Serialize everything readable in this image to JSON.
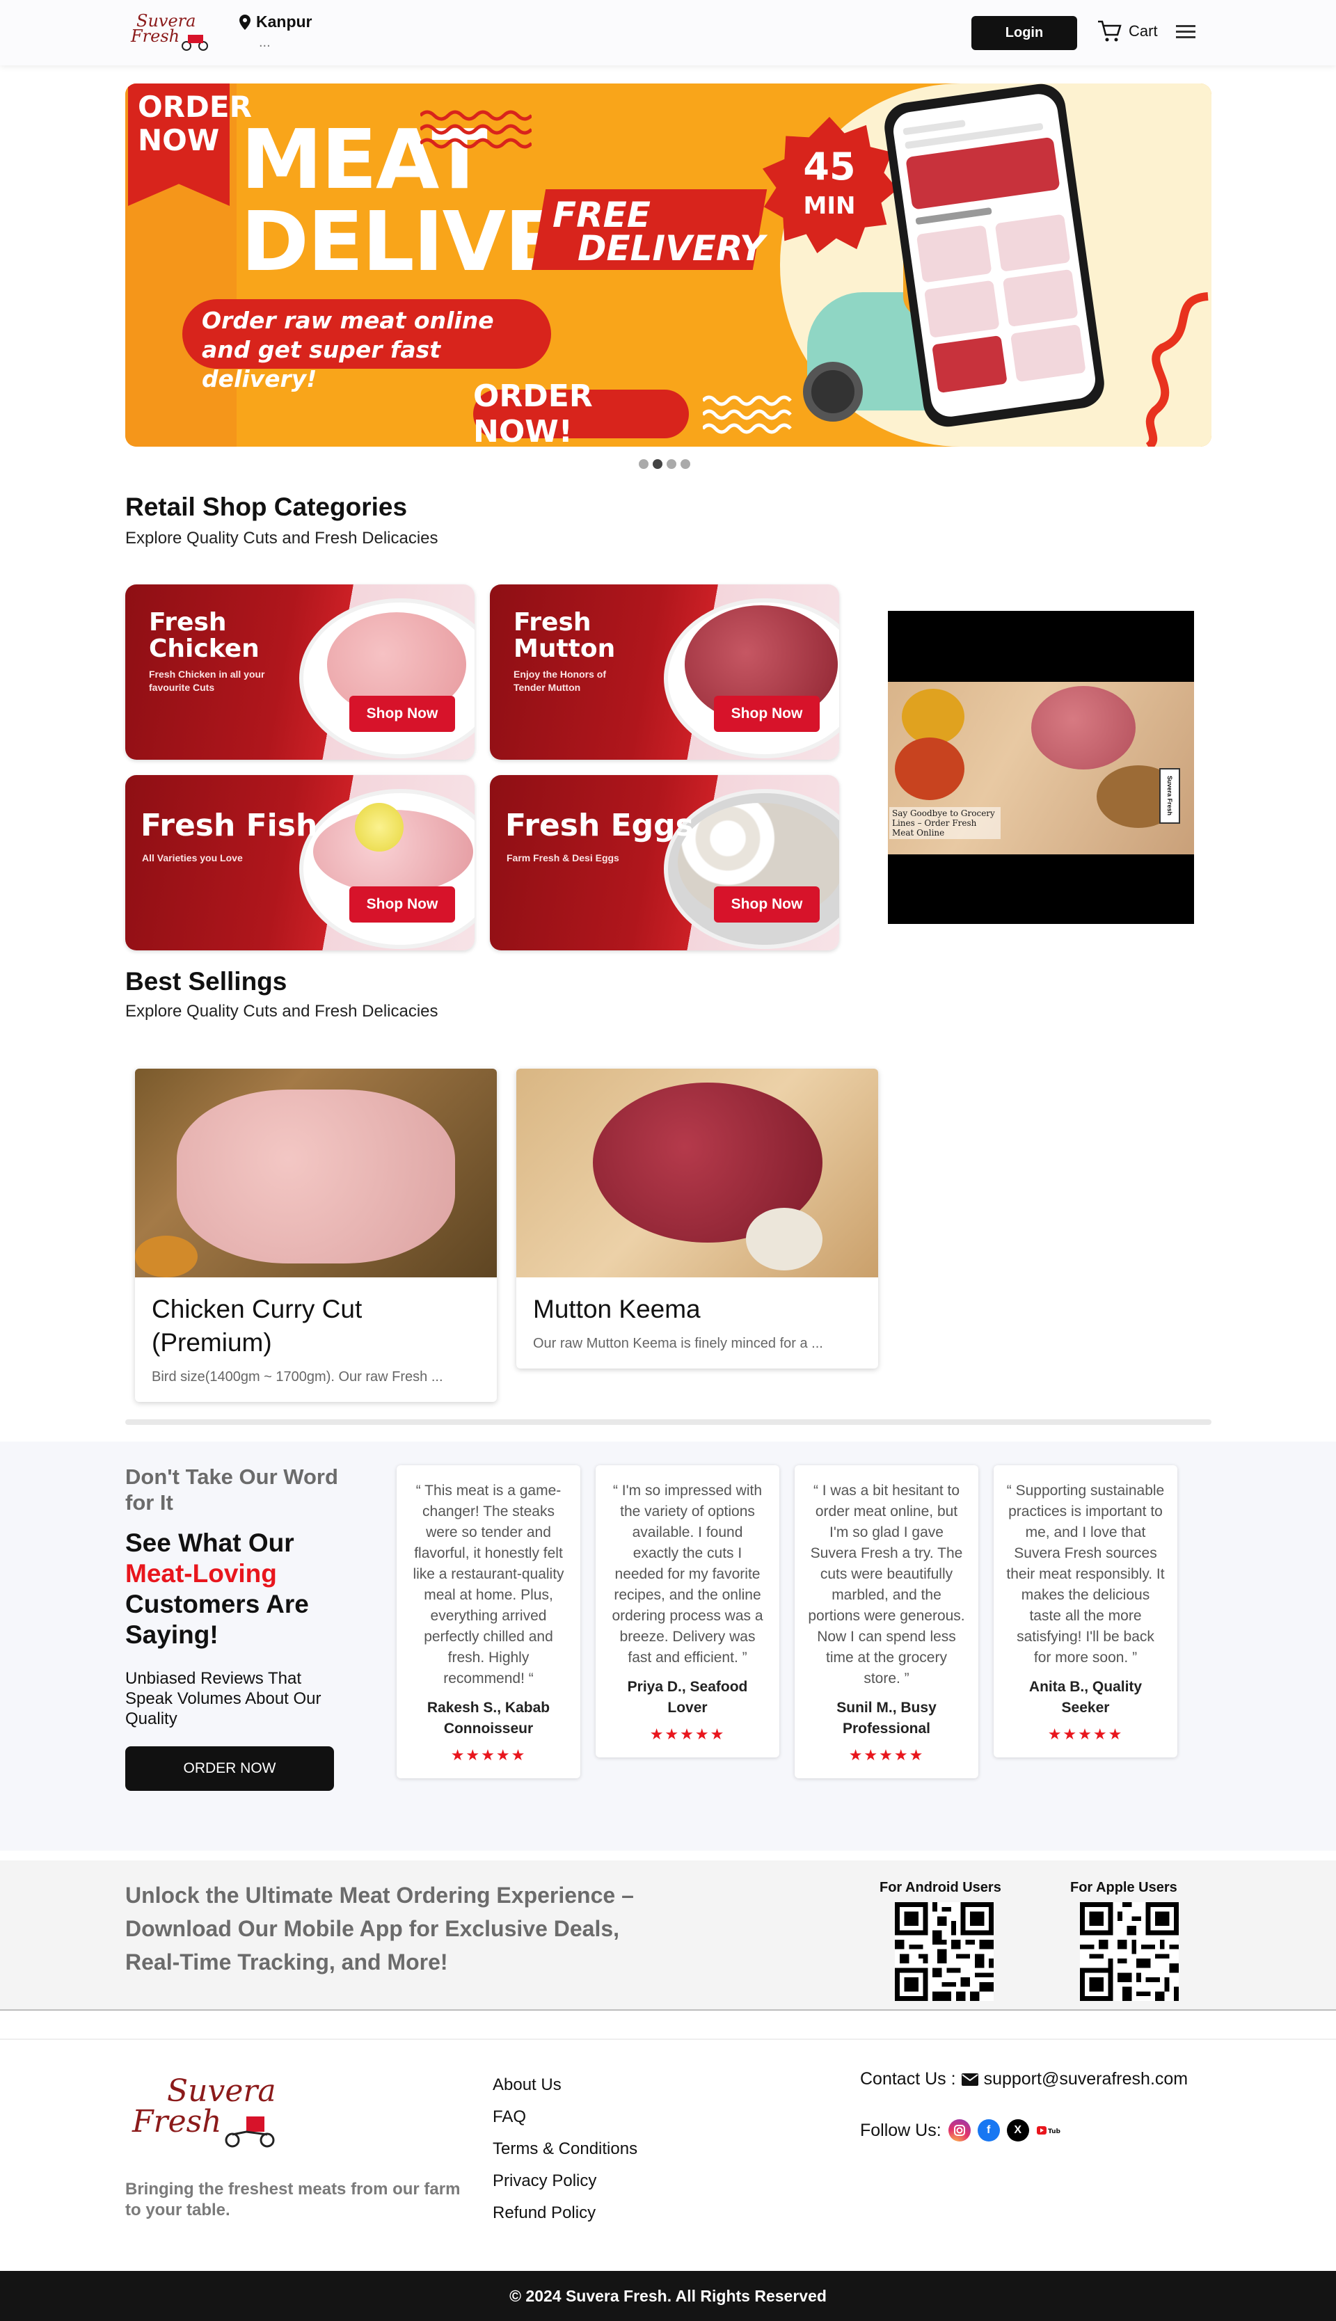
{
  "header": {
    "logo_text": "Suvera Fresh",
    "location_city": "Kanpur",
    "location_sub": "...",
    "login_label": "Login",
    "cart_label": "Cart"
  },
  "hero": {
    "ribbon_text": "ORDER NOW",
    "headline_1": "MEAT",
    "headline_2": "DELIVERY",
    "free_1": "FREE",
    "free_2": "DELIVERY",
    "pill_text": "Order raw meat online and get super fast delivery!",
    "order_now": "ORDER NOW!",
    "badge_num": "45",
    "badge_unit": "MIN",
    "slides_total": 4,
    "slide_active": 2
  },
  "categories_section": {
    "title": "Retail Shop Categories",
    "subtitle": "Explore Quality Cuts and Fresh Delicacies",
    "items": [
      {
        "title_1": "Fresh",
        "title_2": "Chicken",
        "desc": "Fresh Chicken in all your favourite Cuts",
        "button": "Shop Now"
      },
      {
        "title_1": "Fresh",
        "title_2": "Mutton",
        "desc": "Enjoy the Honors of Tender Mutton",
        "button": "Shop Now"
      },
      {
        "title": "Fresh Fish",
        "desc": "All Varieties you Love",
        "button": "Shop Now"
      },
      {
        "title": "Fresh Eggs",
        "desc": "Farm Fresh & Desi Eggs",
        "button": "Shop Now"
      }
    ]
  },
  "video": {
    "caption": "Say Goodbye to Grocery Lines – Order Fresh Meat Online",
    "tag": "Suvera Fresh"
  },
  "best_sellings": {
    "title": "Best Sellings",
    "subtitle": "Explore Quality Cuts and Fresh Delicacies",
    "products": [
      {
        "name": "Chicken Curry Cut (Premium)",
        "desc": "Bird size(1400gm ~ 1700gm). Our raw Fresh ..."
      },
      {
        "name": "Mutton Keema",
        "desc": "Our raw Mutton Keema is finely minced for a ..."
      }
    ]
  },
  "testimonials": {
    "heading_1": "Don't Take Our Word for It",
    "heading_2a": "See What Our",
    "heading_2b": "Meat-Loving",
    "heading_2c": "Customers Are Saying!",
    "paragraph": "Unbiased Reviews That Speak Volumes About Our Quality",
    "button": "ORDER NOW",
    "items": [
      {
        "quote": "“ This meat is a game-changer! The steaks were so tender and flavorful, it honestly felt like a restaurant-quality meal at home. Plus, everything arrived perfectly chilled and fresh. Highly recommend! “",
        "name": "Rakesh S., Kabab Connoisseur",
        "stars": "★★★★★"
      },
      {
        "quote": "“ I'm so impressed with the variety of options available. I found exactly the cuts I needed for my favorite recipes, and the online ordering process was a breeze. Delivery was fast and efficient. ”",
        "name": "Priya D., Seafood Lover",
        "stars": "★★★★★"
      },
      {
        "quote": "“ I was a bit hesitant to order meat online, but I'm so glad I gave Suvera Fresh a try. The cuts were beautifully marbled, and the portions were generous. Now I can spend less time at the grocery store. ”",
        "name": "Sunil M., Busy Professional",
        "stars": "★★★★★"
      },
      {
        "quote": "“ Supporting sustainable practices is important to me, and I love that Suvera Fresh sources their meat responsibly. It makes the delicious taste all the more satisfying! I'll be back for more soon. ”",
        "name": "Anita B., Quality Seeker",
        "stars": "★★★★★"
      }
    ]
  },
  "app_section": {
    "text": "Unlock the Ultimate Meat Ordering Experience – Download Our Mobile App for Exclusive Deals, Real-Time Tracking, and More!",
    "android_label": "For Android Users",
    "apple_label": "For Apple Users"
  },
  "footer": {
    "logo_text": "Suvera Fresh",
    "tagline": "Bringing the freshest meats from our farm to your table.",
    "links": [
      "About Us",
      "FAQ",
      "Terms & Conditions",
      "Privacy Policy",
      "Refund Policy"
    ],
    "contact_label": "Contact Us :",
    "email": "support@suverafresh.com",
    "follow_label": "Follow Us:",
    "socials": [
      "instagram-icon",
      "facebook-icon",
      "x-icon",
      "youtube-icon"
    ],
    "copyright": "© 2024 Suvera Fresh. All Rights Reserved"
  },
  "colors": {
    "brand_red": "#d7132a",
    "accent_red": "#e8161d",
    "hero_orange": "#f9a51a",
    "dark": "#111111"
  }
}
